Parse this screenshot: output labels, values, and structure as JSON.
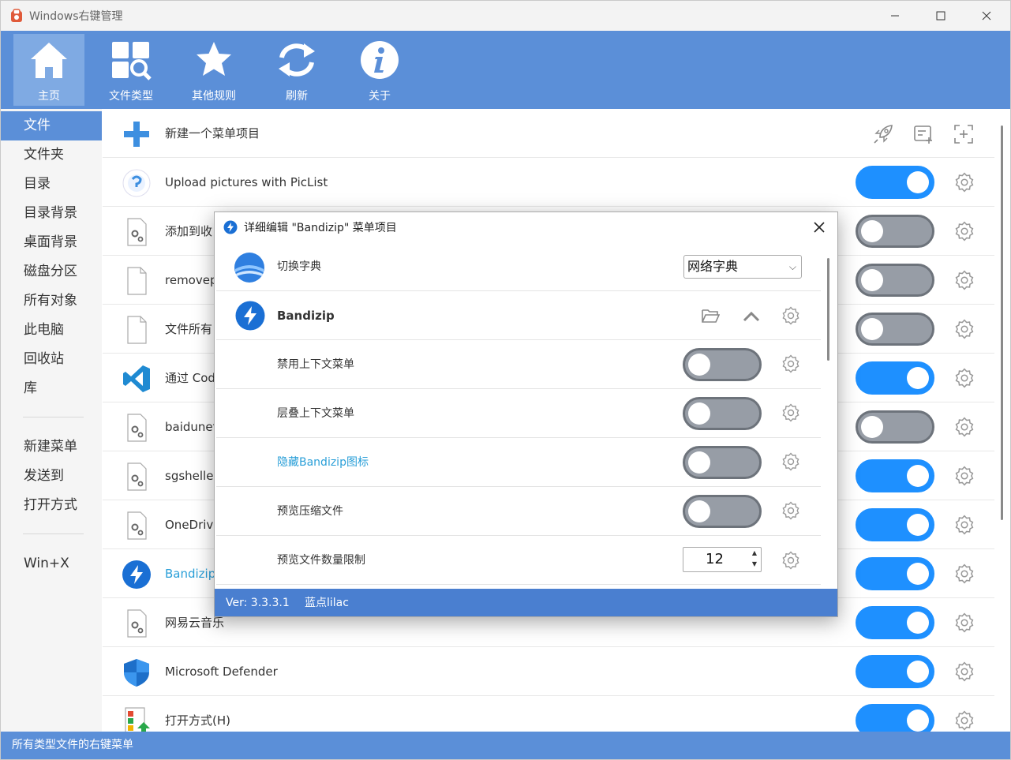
{
  "window": {
    "title": "Windows右键管理"
  },
  "toolbar": [
    {
      "label": "主页",
      "icon": "home-icon"
    },
    {
      "label": "文件类型",
      "icon": "file-type-icon"
    },
    {
      "label": "其他规则",
      "icon": "star-icon"
    },
    {
      "label": "刷新",
      "icon": "refresh-icon"
    },
    {
      "label": "关于",
      "icon": "info-icon"
    }
  ],
  "sidebar": {
    "items": [
      "文件",
      "文件夹",
      "目录",
      "目录背景",
      "桌面背景",
      "磁盘分区",
      "所有对象",
      "此电脑",
      "回收站",
      "库"
    ],
    "items2": [
      "新建菜单",
      "发送到",
      "打开方式"
    ],
    "items3": [
      "Win+X"
    ],
    "active": "文件"
  },
  "list": {
    "new_item": "新建一个菜单项目",
    "rows": [
      {
        "label": "Upload pictures with PicList",
        "on": true,
        "icon": "piclist-icon"
      },
      {
        "label": "添加到收",
        "on": false,
        "icon": "generic-file-gear-icon"
      },
      {
        "label": "removep",
        "on": false,
        "icon": "blank-file-icon"
      },
      {
        "label": "文件所有",
        "on": false,
        "icon": "blank-file-icon"
      },
      {
        "label": "通过 Cod",
        "on": true,
        "icon": "vscode-icon"
      },
      {
        "label": "baidunet",
        "on": false,
        "icon": "generic-file-gear-icon"
      },
      {
        "label": "sgshelle",
        "on": true,
        "icon": "generic-file-gear-icon"
      },
      {
        "label": "OneDrive",
        "on": true,
        "icon": "generic-file-gear-icon"
      },
      {
        "label": "Bandizip",
        "on": true,
        "icon": "bandizip-icon",
        "highlight": true
      },
      {
        "label": "网易云音乐",
        "on": true,
        "icon": "generic-file-gear-icon"
      },
      {
        "label": "Microsoft Defender",
        "on": true,
        "icon": "defender-shield-icon"
      },
      {
        "label": "打开方式(H)",
        "on": true,
        "icon": "open-with-icon"
      }
    ]
  },
  "statusbar": {
    "text": "所有类型文件的右键菜单"
  },
  "dialog": {
    "title": "详细编辑 \"Bandizip\" 菜单项目",
    "dictionary_label": "切换字典",
    "dictionary_value": "网络字典",
    "app_name": "Bandizip",
    "options": [
      {
        "label": "禁用上下文菜单",
        "on": false
      },
      {
        "label": "层叠上下文菜单",
        "on": false
      },
      {
        "label": "隐藏Bandizip图标",
        "on": false,
        "highlight": true
      },
      {
        "label": "预览压缩文件",
        "on": false
      }
    ],
    "limit_label": "预览文件数量限制",
    "limit_value": "12",
    "footer_version": "Ver: 3.3.3.1",
    "footer_author": "蓝点lilac"
  },
  "colors": {
    "accent": "#5b8fd8",
    "toggle_on": "#1e90ff",
    "toggle_off": "#979da6",
    "link": "#2a9fd8"
  }
}
